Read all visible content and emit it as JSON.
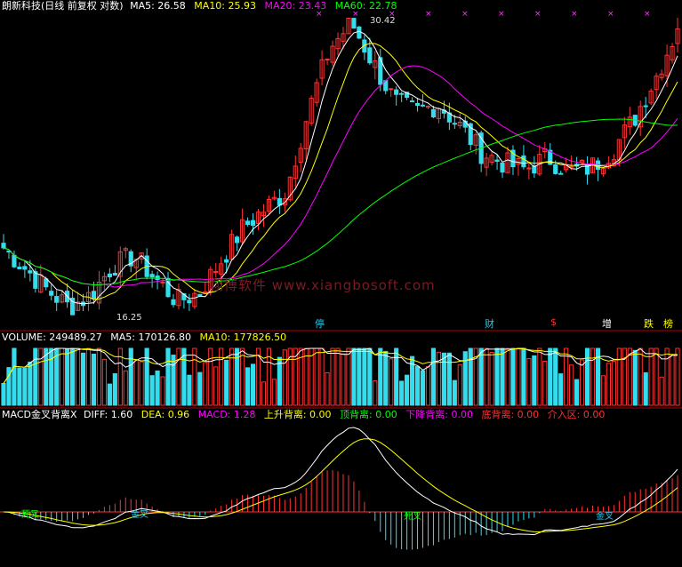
{
  "main_panel": {
    "title": "朗新科技(日线 前复权 对数)",
    "ma": [
      {
        "label": "MA5: 26.58",
        "color": "#ffffff"
      },
      {
        "label": "MA10: 25.93",
        "color": "#ffff00"
      },
      {
        "label": "MA20: 23.43",
        "color": "#ff00ff"
      },
      {
        "label": "MA60: 22.78",
        "color": "#00ff00"
      }
    ],
    "high_label": "30.42",
    "low_label": "16.25",
    "watermark": "翔博软件 www.xiangbosoft.com",
    "events": [
      {
        "text": "停",
        "color": "#22ccee"
      },
      {
        "text": "财",
        "color": "#22ccee"
      },
      {
        "text": "$",
        "color": "#ff3030"
      },
      {
        "text": "增",
        "color": "#ffffff"
      },
      {
        "text": "跌",
        "color": "#ffff00"
      },
      {
        "text": "榜",
        "color": "#ffff00"
      }
    ]
  },
  "volume_panel": {
    "items": [
      {
        "label": "VOLUME: 249489.27",
        "color": "#ffffff"
      },
      {
        "label": "MA5: 170126.80",
        "color": "#ffffff"
      },
      {
        "label": "MA10: 177826.50",
        "color": "#ffff00"
      }
    ]
  },
  "macd_panel": {
    "items": [
      {
        "label": "MACD金叉背离X",
        "color": "#ffffff"
      },
      {
        "label": "DIFF: 1.60",
        "color": "#ffffff"
      },
      {
        "label": "DEA: 0.96",
        "color": "#ffff00"
      },
      {
        "label": "MACD: 1.28",
        "color": "#ff00ff"
      },
      {
        "label": "上升背离: 0.00",
        "color": "#ffff00"
      },
      {
        "label": "顶背离: 0.00",
        "color": "#00ff00"
      },
      {
        "label": "下降背离: 0.00",
        "color": "#ff00ff"
      },
      {
        "label": "底背离: 0.00",
        "color": "#ff3030"
      },
      {
        "label": "介入区: 0.00",
        "color": "#ff3030"
      }
    ],
    "cross_labels": [
      {
        "text": "死叉",
        "color": "#00ff00"
      },
      {
        "text": "金叉",
        "color": "#22ccee"
      },
      {
        "text": "死叉",
        "color": "#00ff00"
      },
      {
        "text": "金叉",
        "color": "#22ccee"
      }
    ]
  },
  "chart_data": {
    "type": "candlestick",
    "series": [
      {
        "name": "MA5",
        "color": "#ffffff"
      },
      {
        "name": "MA10",
        "color": "#ffff00"
      },
      {
        "name": "MA20",
        "color": "#ff00ff"
      },
      {
        "name": "MA60",
        "color": "#00ff00"
      }
    ],
    "high": 30.42,
    "low": 16.25,
    "close_points": [
      18.6,
      17.8,
      17.0,
      16.4,
      16.8,
      17.9,
      18.3,
      17.4,
      16.6,
      16.9,
      18.1,
      19.4,
      20.2,
      21.0,
      24.8,
      28.5,
      30.1,
      27.6,
      25.4,
      24.9,
      25.3,
      24.1,
      22.8,
      22.3,
      22.0,
      22.6,
      21.9,
      22.1,
      22.9,
      24.5,
      26.8,
      29.7
    ]
  }
}
